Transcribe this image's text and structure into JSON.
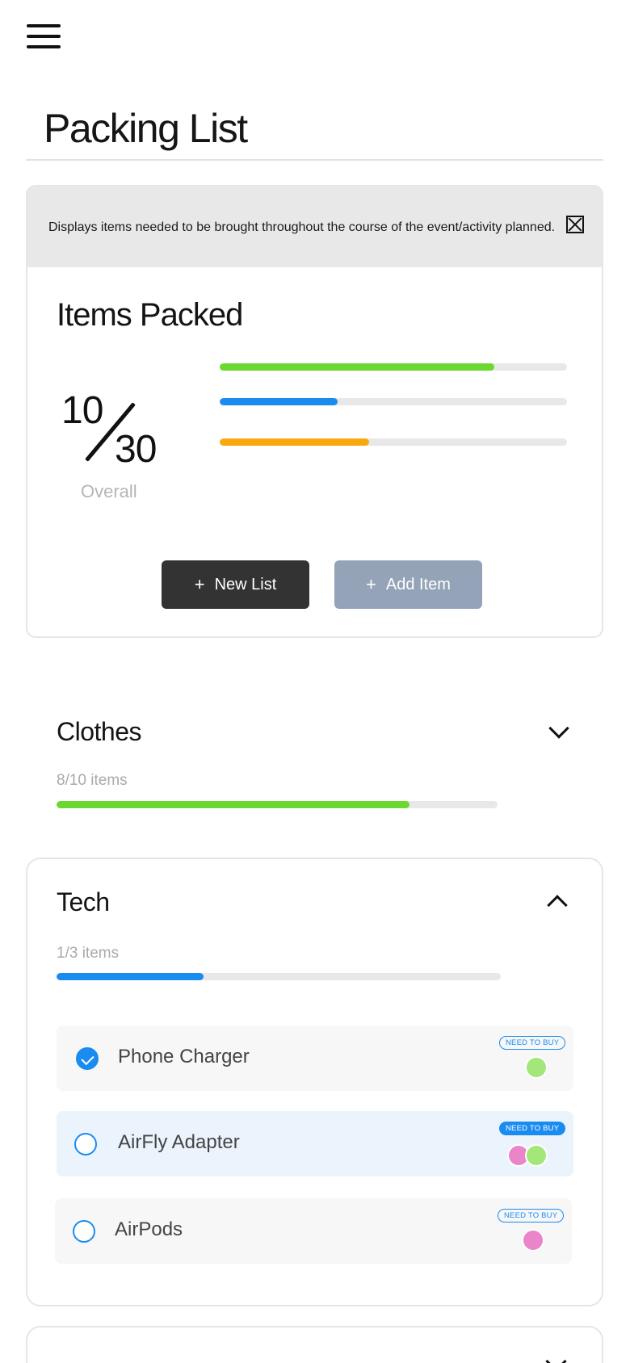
{
  "header": {
    "menu_icon": "hamburger-menu-icon",
    "title": "Packing List"
  },
  "info_banner": {
    "text": "Displays items needed to be brought throughout the course of the event/activity planned.",
    "close_icon": "close-box-icon"
  },
  "summary": {
    "heading": "Items Packed",
    "packed": "10",
    "total": "30",
    "overall_label": "Overall",
    "bars": [
      {
        "color": "#6ad82e",
        "fraction": 0.79
      },
      {
        "color": "#1a8cf0",
        "fraction": 0.34
      },
      {
        "color": "#f9a90f",
        "fraction": 0.43
      }
    ],
    "buttons": {
      "new_list": "New List",
      "add_item": "Add Item",
      "plus_icon": "+"
    }
  },
  "categories": {
    "clothes": {
      "title": "Clothes",
      "count": "8/10 items",
      "progress": 0.8,
      "color": "#6ad82e",
      "expanded": false
    },
    "tech": {
      "title": "Tech",
      "count": "1/3 items",
      "progress": 0.33,
      "color": "#1a8cf0",
      "expanded": true,
      "items": [
        {
          "label": "Phone Charger",
          "checked": true,
          "tag": "NEED TO BUY",
          "tag_style": "outline",
          "avatars": [
            "#a3e67a"
          ]
        },
        {
          "label": "AirFly Adapter",
          "checked": false,
          "tag": "NEED TO BUY",
          "tag_style": "filled",
          "avatars": [
            "#ea85c9",
            "#a3e67a"
          ]
        },
        {
          "label": "AirPods",
          "checked": false,
          "tag": "NEED TO BUY",
          "tag_style": "outline",
          "avatars": [
            "#ea85c9"
          ]
        }
      ]
    }
  },
  "colors": {
    "accent_blue": "#1a8cf0",
    "green": "#6ad82e",
    "orange": "#f9a90f",
    "dark_button": "#333333",
    "muted_button": "#94a3b8"
  }
}
